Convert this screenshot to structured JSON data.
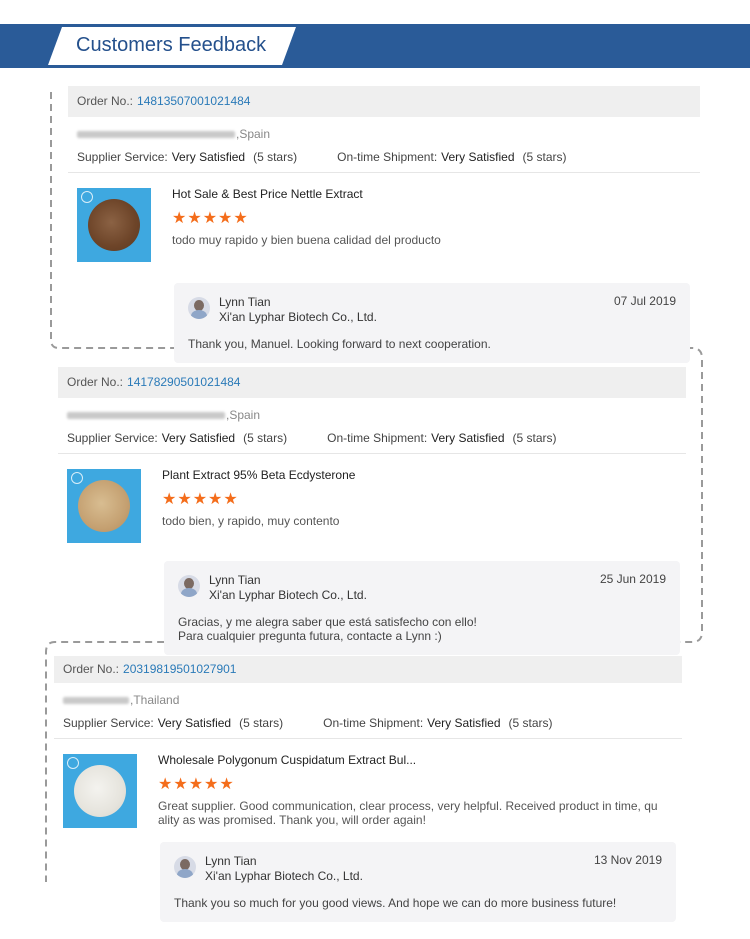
{
  "header": {
    "title": "Customers Feedback"
  },
  "labels": {
    "order_no": "Order No.:",
    "supplier_service": "Supplier Service:",
    "ontime_shipment": "On-time Shipment:"
  },
  "reviews": [
    {
      "order_no": "14813507001021484",
      "buyer_country": ",Spain",
      "supplier_service": "Very Satisfied",
      "supplier_stars": "(5 stars)",
      "shipment": "Very Satisfied",
      "shipment_stars": "(5 stars)",
      "product_title": "Hot Sale & Best Price Nettle Extract",
      "rating": 5,
      "review_text": "todo muy rapido y bien buena calidad del producto",
      "reply": {
        "name": "Lynn Tian",
        "company": "Xi'an Lyphar Biotech Co., Ltd.",
        "date": "07 Jul 2019",
        "text": "Thank you, Manuel. Looking forward to next cooperation."
      },
      "powder_color": "#7a5236"
    },
    {
      "order_no": "14178290501021484",
      "buyer_country": ",Spain",
      "supplier_service": "Very Satisfied",
      "supplier_stars": "(5 stars)",
      "shipment": "Very Satisfied",
      "shipment_stars": "(5 stars)",
      "product_title": "Plant Extract 95% Beta Ecdysterone",
      "rating": 5,
      "review_text": "todo bien, y rapido, muy contento",
      "reply": {
        "name": "Lynn Tian",
        "company": "Xi'an Lyphar Biotech Co., Ltd.",
        "date": "25 Jun 2019",
        "text_line1": "Gracias, y me alegra saber que está satisfecho con ello!",
        "text_line2": "Para cualquier pregunta futura, contacte a Lynn :)"
      },
      "powder_color": "#c9a97a"
    },
    {
      "order_no": "20319819501027901",
      "buyer_country": ",Thailand",
      "supplier_service": "Very Satisfied",
      "supplier_stars": "(5 stars)",
      "shipment": "Very Satisfied",
      "shipment_stars": "(5 stars)",
      "product_title": "Wholesale Polygonum Cuspidatum Extract Bul...",
      "rating": 5,
      "review_text_line1": "Great supplier. Good communication, clear process, very helpful. Received product in time, qu",
      "review_text_line2": "ality as was promised. Thank you, will order again!",
      "reply": {
        "name": "Lynn Tian",
        "company": "Xi'an Lyphar Biotech Co., Ltd.",
        "date": "13 Nov 2019",
        "text": "Thank you so much for you good views. And hope we can do more business future!"
      },
      "powder_color": "#e8e6df"
    }
  ],
  "icons": {
    "star": "star-icon",
    "avatar": "avatar",
    "logo_mark": "brand-watermark-icon"
  },
  "colors": {
    "banner": "#2a5b98",
    "title": "#24508c",
    "order_link": "#2a7ab8",
    "star": "#f46d1b",
    "thumb_bg": "#3ea8e0"
  }
}
